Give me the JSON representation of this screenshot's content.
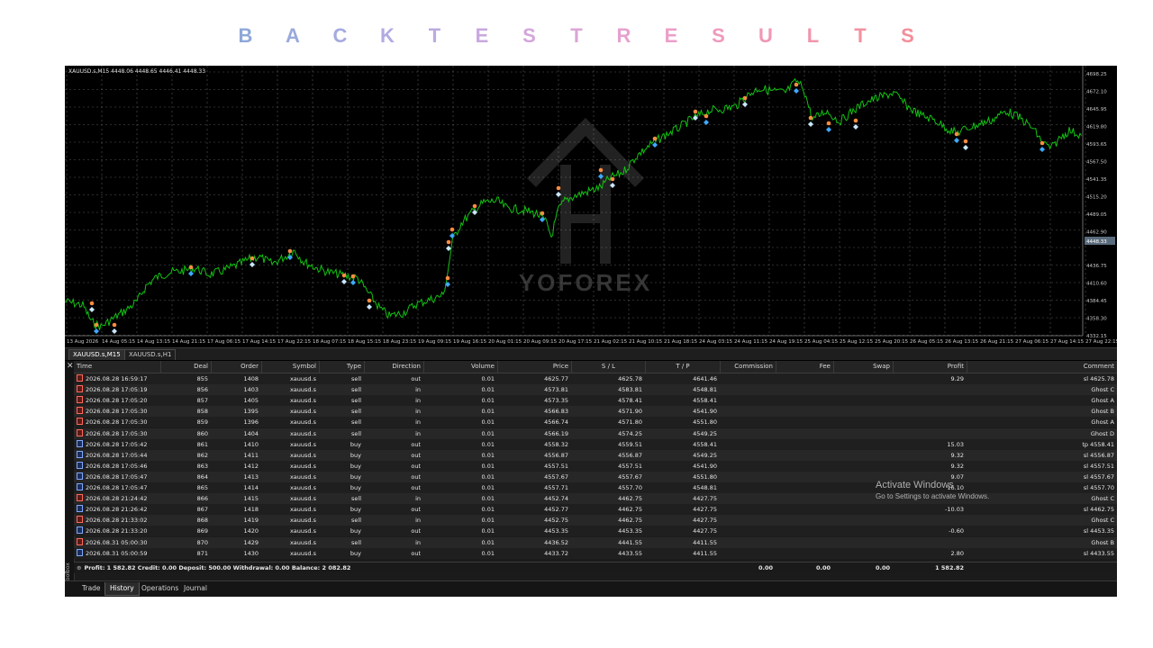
{
  "banner": {
    "letters": [
      {
        "char": "B",
        "color": "#8ea8d8"
      },
      {
        "char": "A",
        "color": "#9aa9dc"
      },
      {
        "char": "C",
        "color": "#a6aadf"
      },
      {
        "char": "K",
        "color": "#b1abe0"
      },
      {
        "char": "T",
        "color": "#bcaae0"
      },
      {
        "char": "E",
        "color": "#c8a8df"
      },
      {
        "char": "S",
        "color": "#d4a6dc"
      },
      {
        "char": "T",
        "color": "#dea4d6"
      },
      {
        "char": "R",
        "color": "#e6a1cf"
      },
      {
        "char": "E",
        "color": "#ec9ec7"
      },
      {
        "char": "S",
        "color": "#ef9abd"
      },
      {
        "char": "U",
        "color": "#f197b4"
      },
      {
        "char": "L",
        "color": "#f294ab"
      },
      {
        "char": "T",
        "color": "#f391a2"
      },
      {
        "char": "S",
        "color": "#f38e99"
      }
    ]
  },
  "chart": {
    "header": "XAUUSD.s,M15  4448.06 4448.65 4446.41 4448.33",
    "line_color": "#12c212",
    "price_labels": [
      "4698.25",
      "4672.10",
      "4645.95",
      "4619.80",
      "4593.65",
      "4567.50",
      "4541.35",
      "4515.20",
      "4489.05",
      "4462.90",
      "4448.33",
      "4436.75",
      "4410.60",
      "4384.45",
      "4358.30",
      "4332.15"
    ],
    "time_labels": [
      "13 Aug 2026",
      "14 Aug 05:15",
      "14 Aug 13:15",
      "14 Aug 21:15",
      "17 Aug 06:15",
      "17 Aug 14:15",
      "17 Aug 22:15",
      "18 Aug 07:15",
      "18 Aug 15:15",
      "18 Aug 23:15",
      "19 Aug 09:15",
      "19 Aug 16:15",
      "20 Aug 01:15",
      "20 Aug 09:15",
      "20 Aug 17:15",
      "21 Aug 02:15",
      "21 Aug 10:15",
      "21 Aug 18:15",
      "24 Aug 03:15",
      "24 Aug 11:15",
      "24 Aug 19:15",
      "25 Aug 04:15",
      "25 Aug 12:15",
      "25 Aug 20:15",
      "26 Aug 05:15",
      "26 Aug 13:15",
      "26 Aug 21:15",
      "27 Aug 06:15",
      "27 Aug 14:15",
      "27 Aug 22:15"
    ],
    "watermark": "YOFOREX"
  },
  "chart_tabs": [
    "XAUUSD.s,M15",
    "XAUUSD.s,H1"
  ],
  "table": {
    "headers": [
      "Time",
      "Deal",
      "Order",
      "Symbol",
      "Type",
      "Direction",
      "Volume",
      "Price",
      "S / L",
      "T / P",
      "Commission",
      "Fee",
      "Swap",
      "Profit",
      "Comment"
    ],
    "rows": [
      [
        "2026.08.28 16:59:17",
        "855",
        "1408",
        "xauusd.s",
        "sell",
        "out",
        "0.01",
        "4625.77",
        "4625.78",
        "4641.46",
        "",
        "",
        "",
        "9.29",
        "sl 4625.78"
      ],
      [
        "2026.08.28 17:05:19",
        "856",
        "1403",
        "xauusd.s",
        "sell",
        "in",
        "0.01",
        "4573.81",
        "4583.81",
        "4548.81",
        "",
        "",
        "",
        "",
        "Ghost C"
      ],
      [
        "2026.08.28 17:05:20",
        "857",
        "1405",
        "xauusd.s",
        "sell",
        "in",
        "0.01",
        "4573.35",
        "4578.41",
        "4558.41",
        "",
        "",
        "",
        "",
        "Ghost A"
      ],
      [
        "2026.08.28 17:05:30",
        "858",
        "1395",
        "xauusd.s",
        "sell",
        "in",
        "0.01",
        "4566.83",
        "4571.90",
        "4541.90",
        "",
        "",
        "",
        "",
        "Ghost B"
      ],
      [
        "2026.08.28 17:05:30",
        "859",
        "1396",
        "xauusd.s",
        "sell",
        "in",
        "0.01",
        "4566.74",
        "4571.80",
        "4551.80",
        "",
        "",
        "",
        "",
        "Ghost A"
      ],
      [
        "2026.08.28 17:05:30",
        "860",
        "1404",
        "xauusd.s",
        "sell",
        "in",
        "0.01",
        "4566.19",
        "4574.25",
        "4549.25",
        "",
        "",
        "",
        "",
        "Ghost D"
      ],
      [
        "2026.08.28 17:05:42",
        "861",
        "1410",
        "xauusd.s",
        "buy",
        "out",
        "0.01",
        "4558.32",
        "4559.51",
        "4558.41",
        "",
        "",
        "",
        "15.03",
        "tp 4558.41"
      ],
      [
        "2026.08.28 17:05:44",
        "862",
        "1411",
        "xauusd.s",
        "buy",
        "out",
        "0.01",
        "4556.87",
        "4556.87",
        "4549.25",
        "",
        "",
        "",
        "9.32",
        "sl 4556.87"
      ],
      [
        "2026.08.28 17:05:46",
        "863",
        "1412",
        "xauusd.s",
        "buy",
        "out",
        "0.01",
        "4557.51",
        "4557.51",
        "4541.90",
        "",
        "",
        "",
        "9.32",
        "sl 4557.51"
      ],
      [
        "2026.08.28 17:05:47",
        "864",
        "1413",
        "xauusd.s",
        "buy",
        "out",
        "0.01",
        "4557.67",
        "4557.67",
        "4551.80",
        "",
        "",
        "",
        "9.07",
        "sl 4557.67"
      ],
      [
        "2026.08.28 17:05:47",
        "865",
        "1414",
        "xauusd.s",
        "buy",
        "out",
        "0.01",
        "4557.71",
        "4557.70",
        "4548.81",
        "",
        "",
        "",
        "16.10",
        "sl 4557.70"
      ],
      [
        "2026.08.28 21:24:42",
        "866",
        "1415",
        "xauusd.s",
        "sell",
        "in",
        "0.01",
        "4452.74",
        "4462.75",
        "4427.75",
        "",
        "",
        "",
        "",
        "Ghost C"
      ],
      [
        "2026.08.28 21:26:42",
        "867",
        "1418",
        "xauusd.s",
        "buy",
        "out",
        "0.01",
        "4452.77",
        "4462.75",
        "4427.75",
        "",
        "",
        "",
        "-10.03",
        "sl 4462.75"
      ],
      [
        "2026.08.28 21:33:02",
        "868",
        "1419",
        "xauusd.s",
        "sell",
        "in",
        "0.01",
        "4452.75",
        "4462.75",
        "4427.75",
        "",
        "",
        "",
        "",
        "Ghost C"
      ],
      [
        "2026.08.28 21:33:20",
        "869",
        "1420",
        "xauusd.s",
        "buy",
        "out",
        "0.01",
        "4453.35",
        "4453.35",
        "4427.75",
        "",
        "",
        "",
        "-0.60",
        "sl 4453.35"
      ],
      [
        "2026.08.31 05:00:30",
        "870",
        "1429",
        "xauusd.s",
        "sell",
        "in",
        "0.01",
        "4436.52",
        "4441.55",
        "4411.55",
        "",
        "",
        "",
        "",
        "Ghost B"
      ],
      [
        "2026.08.31 05:00:59",
        "871",
        "1430",
        "xauusd.s",
        "buy",
        "out",
        "0.01",
        "4433.72",
        "4433.55",
        "4411.55",
        "",
        "",
        "",
        "2.80",
        "sl 4433.55"
      ]
    ],
    "summary": {
      "text": "Profit: 1 582.82  Credit: 0.00  Deposit: 500.00  Withdrawal: 0.00  Balance: 2 082.82",
      "commission": "0.00",
      "fee": "0.00",
      "swap": "0.00",
      "profit": "1 582.82"
    }
  },
  "side_label": "Toolbox",
  "bottom_tabs": [
    "Trade",
    "History",
    "Operations",
    "Journal"
  ],
  "activate": {
    "line1": "Activate Windows",
    "line2": "Go to Settings to activate Windows."
  }
}
